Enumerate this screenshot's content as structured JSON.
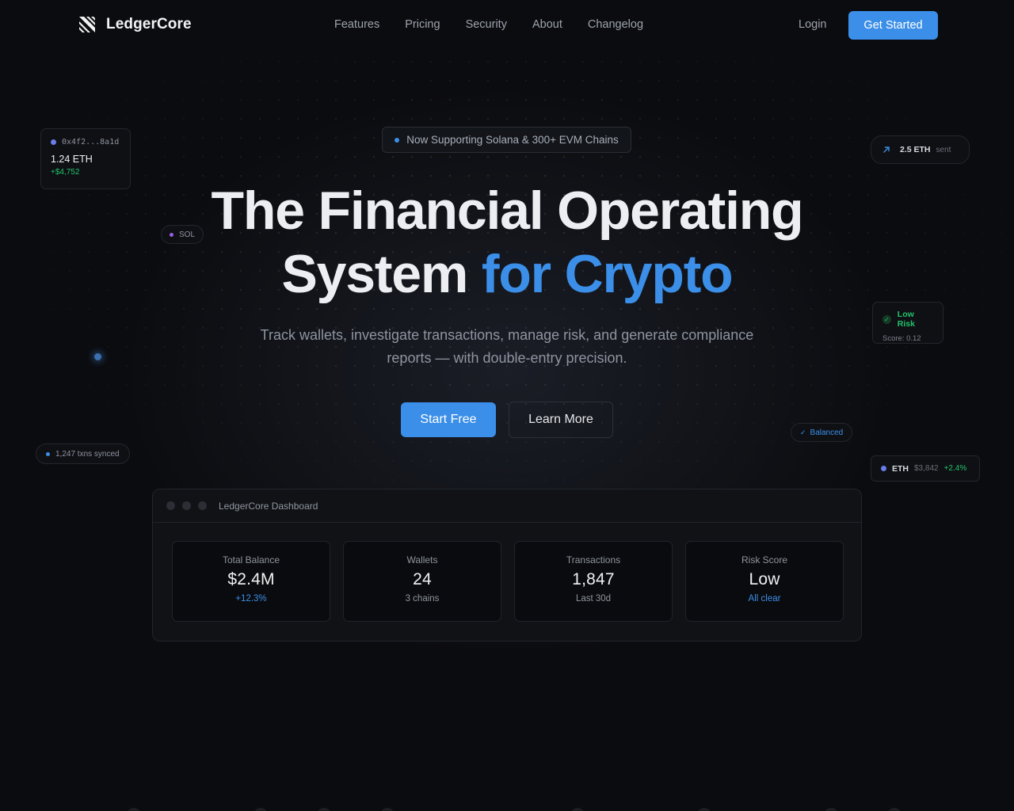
{
  "nav": {
    "brand": "LedgerCore",
    "links": [
      "Features",
      "Pricing",
      "Security",
      "About",
      "Changelog"
    ],
    "login": "Login",
    "cta": "Get Started"
  },
  "hero": {
    "badge": "Now Supporting Solana & 300+ EVM Chains",
    "title_line1": "The Financial Operating",
    "title_line2_plain": "System ",
    "title_line2_accent": "for Crypto",
    "subtitle": "Track wallets, investigate transactions, manage risk, and generate compliance reports — with double-entry precision.",
    "primary_cta": "Start Free",
    "secondary_cta": "Learn More"
  },
  "floating": {
    "wallet": {
      "address": "0x4f2...8a1d",
      "amount": "1.24 ETH",
      "delta": "+$4,752"
    },
    "sol": "SOL",
    "txns": "1,247 txns synced",
    "eth_sent": {
      "amount": "2.5 ETH",
      "label": "sent"
    },
    "risk": {
      "title": "Low Risk",
      "score": "Score: 0.12"
    },
    "balanced": "Balanced",
    "eth_price": {
      "symbol": "ETH",
      "price": "$3,842",
      "change": "+2.4%"
    }
  },
  "dashboard": {
    "title": "LedgerCore Dashboard",
    "stats": [
      {
        "label": "Total Balance",
        "value": "$2.4M",
        "note": "+12.3%"
      },
      {
        "label": "Wallets",
        "value": "24",
        "note": "3 chains"
      },
      {
        "label": "Transactions",
        "value": "1,847",
        "note": "Last 30d"
      },
      {
        "label": "Risk Score",
        "value": "Low",
        "note": "All clear"
      }
    ]
  },
  "colors": {
    "background": "#0b0c0f",
    "accent": "#3b8fe8",
    "positive": "#22c36b",
    "muted_text": "#8e949f"
  },
  "icons": [
    "logo-icon",
    "arrow-up-right-icon",
    "check-icon"
  ]
}
